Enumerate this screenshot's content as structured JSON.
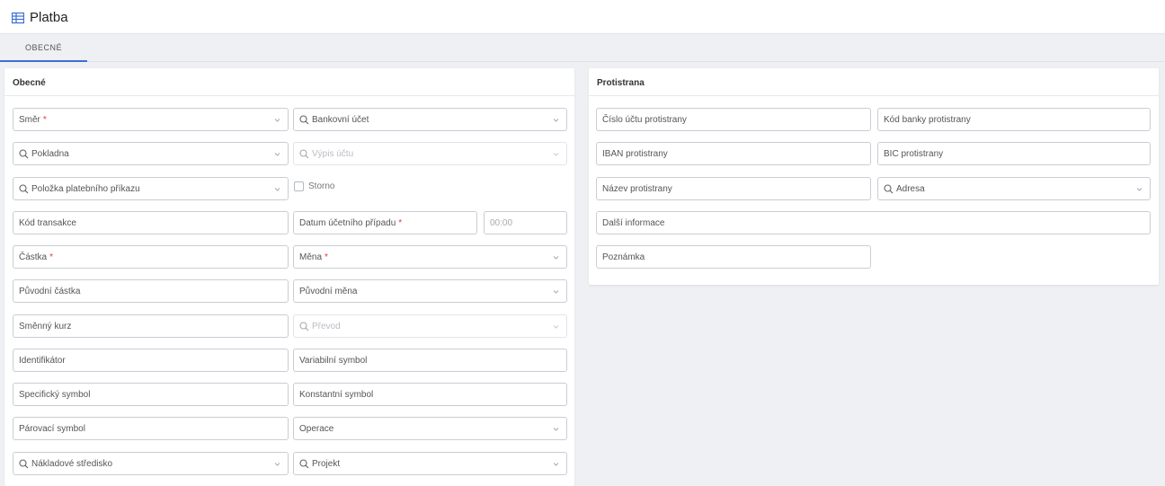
{
  "header": {
    "title": "Platba",
    "icon": "table-icon"
  },
  "tabs": [
    {
      "label": "OBECNÉ"
    }
  ],
  "left_panel": {
    "title": "Obecné",
    "fields": {
      "smer": {
        "label": "Směr",
        "required": "*"
      },
      "bankovni_ucet": {
        "label": "Bankovní účet"
      },
      "pokladna": {
        "label": "Pokladna"
      },
      "vypis_uctu": {
        "label": "Výpis účtu"
      },
      "polozka": {
        "label": "Položka platebního příkazu"
      },
      "storno": {
        "label": "Storno"
      },
      "kod_transakce": {
        "label": "Kód transakce"
      },
      "datum": {
        "label": "Datum účetního případu",
        "required": "*"
      },
      "cas": {
        "label": "00:00"
      },
      "castka": {
        "label": "Částka",
        "required": "*"
      },
      "mena": {
        "label": "Měna",
        "required": "*"
      },
      "puvodni_castka": {
        "label": "Původní částka"
      },
      "puvodni_mena": {
        "label": "Původní měna"
      },
      "smenny_kurz": {
        "label": "Směnný kurz"
      },
      "prevod": {
        "label": "Převod"
      },
      "identifikator": {
        "label": "Identifikátor"
      },
      "variabilni_symbol": {
        "label": "Variabilní symbol"
      },
      "specificky_symbol": {
        "label": "Specifický symbol"
      },
      "konstantni_symbol": {
        "label": "Konstantní symbol"
      },
      "parovaci_symbol": {
        "label": "Párovací symbol"
      },
      "operace": {
        "label": "Operace"
      },
      "nakladove_stredisko": {
        "label": "Nákladové středisko"
      },
      "projekt": {
        "label": "Projekt"
      }
    }
  },
  "right_panel": {
    "title": "Protistrana",
    "fields": {
      "cislo_uctu": {
        "label": "Číslo účtu protistrany"
      },
      "kod_banky": {
        "label": "Kód banky protistrany"
      },
      "iban": {
        "label": "IBAN protistrany"
      },
      "bic": {
        "label": "BIC protistrany"
      },
      "nazev": {
        "label": "Název protistrany"
      },
      "adresa": {
        "label": "Adresa"
      },
      "dalsi_informace": {
        "label": "Další informace"
      },
      "poznamka": {
        "label": "Poznámka"
      }
    }
  },
  "colors": {
    "accent": "#3b6fd4",
    "required": "#e5383b",
    "border": "#c9cdd2"
  }
}
